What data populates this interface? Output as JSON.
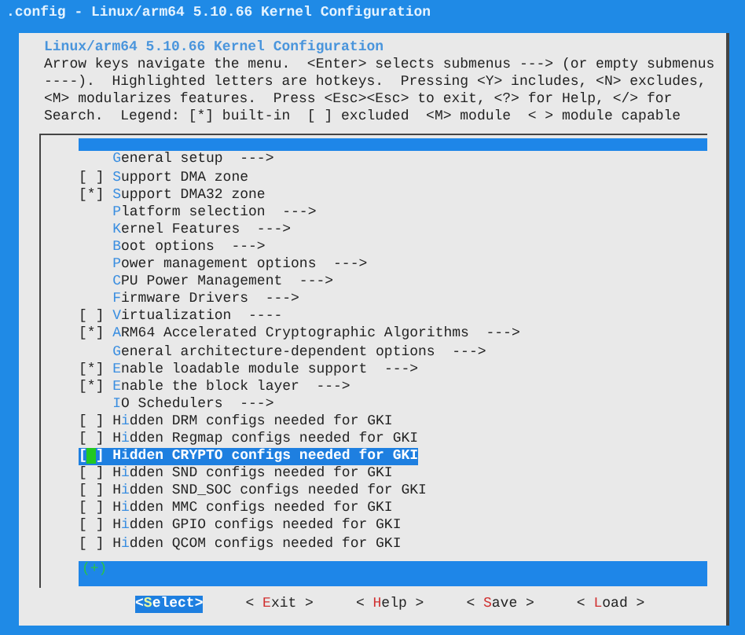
{
  "window": {
    "title": ".config - Linux/arm64 5.10.66 Kernel Configuration"
  },
  "dialog": {
    "title": "Linux/arm64 5.10.66 Kernel Configuration",
    "help_lines": [
      "Arrow keys navigate the menu.  <Enter> selects submenus ---> (or empty submenus",
      "----).  Highlighted letters are hotkeys.  Pressing <Y> includes, <N> excludes,",
      "<M> modularizes features.  Press <Esc><Esc> to exit, <?> for Help, </> for",
      "Search.  Legend: [*] built-in  [ ] excluded  <M> module  < > module capable"
    ]
  },
  "menu": {
    "items": [
      {
        "hotkey": "G",
        "rest": "eneral setup",
        "arrow": "--->",
        "selected": false
      },
      {
        "box": "[ ]",
        "hotkey": "S",
        "rest": "upport DMA zone",
        "selected": false
      },
      {
        "box": "[*]",
        "hotkey": "S",
        "rest": "upport DMA32 zone",
        "selected": false
      },
      {
        "hotkey": "P",
        "rest": "latform selection",
        "arrow": "--->",
        "selected": false
      },
      {
        "hotkey": "K",
        "rest": "ernel Features",
        "arrow": "--->",
        "selected": false
      },
      {
        "hotkey": "B",
        "rest": "oot options",
        "arrow": "--->",
        "selected": false
      },
      {
        "hotkey": "P",
        "rest": "ower management options",
        "arrow": "--->",
        "selected": false
      },
      {
        "hotkey": "C",
        "rest": "PU Power Management",
        "arrow": "--->",
        "selected": false
      },
      {
        "hotkey": "F",
        "rest": "irmware Drivers",
        "arrow": "--->",
        "selected": false
      },
      {
        "box": "[ ]",
        "hotkey": "V",
        "rest": "irtualization",
        "arrow": "----",
        "selected": false
      },
      {
        "box": "[*]",
        "hotkey": "A",
        "rest": "RM64 Accelerated Cryptographic Algorithms",
        "arrow": "--->",
        "selected": false
      },
      {
        "hotkey": "G",
        "rest": "eneral architecture-dependent options",
        "arrow": "--->",
        "selected": false
      },
      {
        "box": "[*]",
        "hotkey": "E",
        "rest": "nable loadable module support",
        "arrow": "--->",
        "selected": false
      },
      {
        "box": "[*]",
        "hotkey": "E",
        "rest": "nable the block layer",
        "arrow": "--->",
        "selected": false
      },
      {
        "hotkey": "I",
        "rest": "O Schedulers",
        "arrow": "--->",
        "selected": false
      },
      {
        "box": "[ ]",
        "lead": "H",
        "hotkey": "i",
        "rest": "dden DRM configs needed for GKI",
        "selected": false
      },
      {
        "box": "[ ]",
        "lead": "H",
        "hotkey": "i",
        "rest": "dden Regmap configs needed for GKI",
        "selected": false
      },
      {
        "box": "[ ]",
        "lead": "H",
        "hotkey": "i",
        "rest": "dden CRYPTO configs needed for GKI",
        "selected": true
      },
      {
        "box": "[ ]",
        "lead": "H",
        "hotkey": "i",
        "rest": "dden SND configs needed for GKI",
        "selected": false
      },
      {
        "box": "[ ]",
        "lead": "H",
        "hotkey": "i",
        "rest": "dden SND_SOC configs needed for GKI",
        "selected": false
      },
      {
        "box": "[ ]",
        "lead": "H",
        "hotkey": "i",
        "rest": "dden MMC configs needed for GKI",
        "selected": false
      },
      {
        "box": "[ ]",
        "lead": "H",
        "hotkey": "i",
        "rest": "dden GPIO configs needed for GKI",
        "selected": false
      },
      {
        "box": "[ ]",
        "lead": "H",
        "hotkey": "i",
        "rest": "dden QCOM configs needed for GKI",
        "selected": false
      }
    ],
    "more_indicator": "(+)"
  },
  "buttons": [
    {
      "left": "<",
      "hotkey": "S",
      "rest": "elect",
      "right": ">",
      "selected": true
    },
    {
      "left": "< ",
      "hotkey": "E",
      "rest": "xit",
      "right": " >",
      "selected": false
    },
    {
      "left": "< ",
      "hotkey": "H",
      "rest": "elp",
      "right": " >",
      "selected": false
    },
    {
      "left": "< ",
      "hotkey": "S",
      "rest": "ave",
      "right": " >",
      "selected": false
    },
    {
      "left": "< ",
      "hotkey": "L",
      "rest": "oad",
      "right": " >",
      "selected": false
    }
  ]
}
